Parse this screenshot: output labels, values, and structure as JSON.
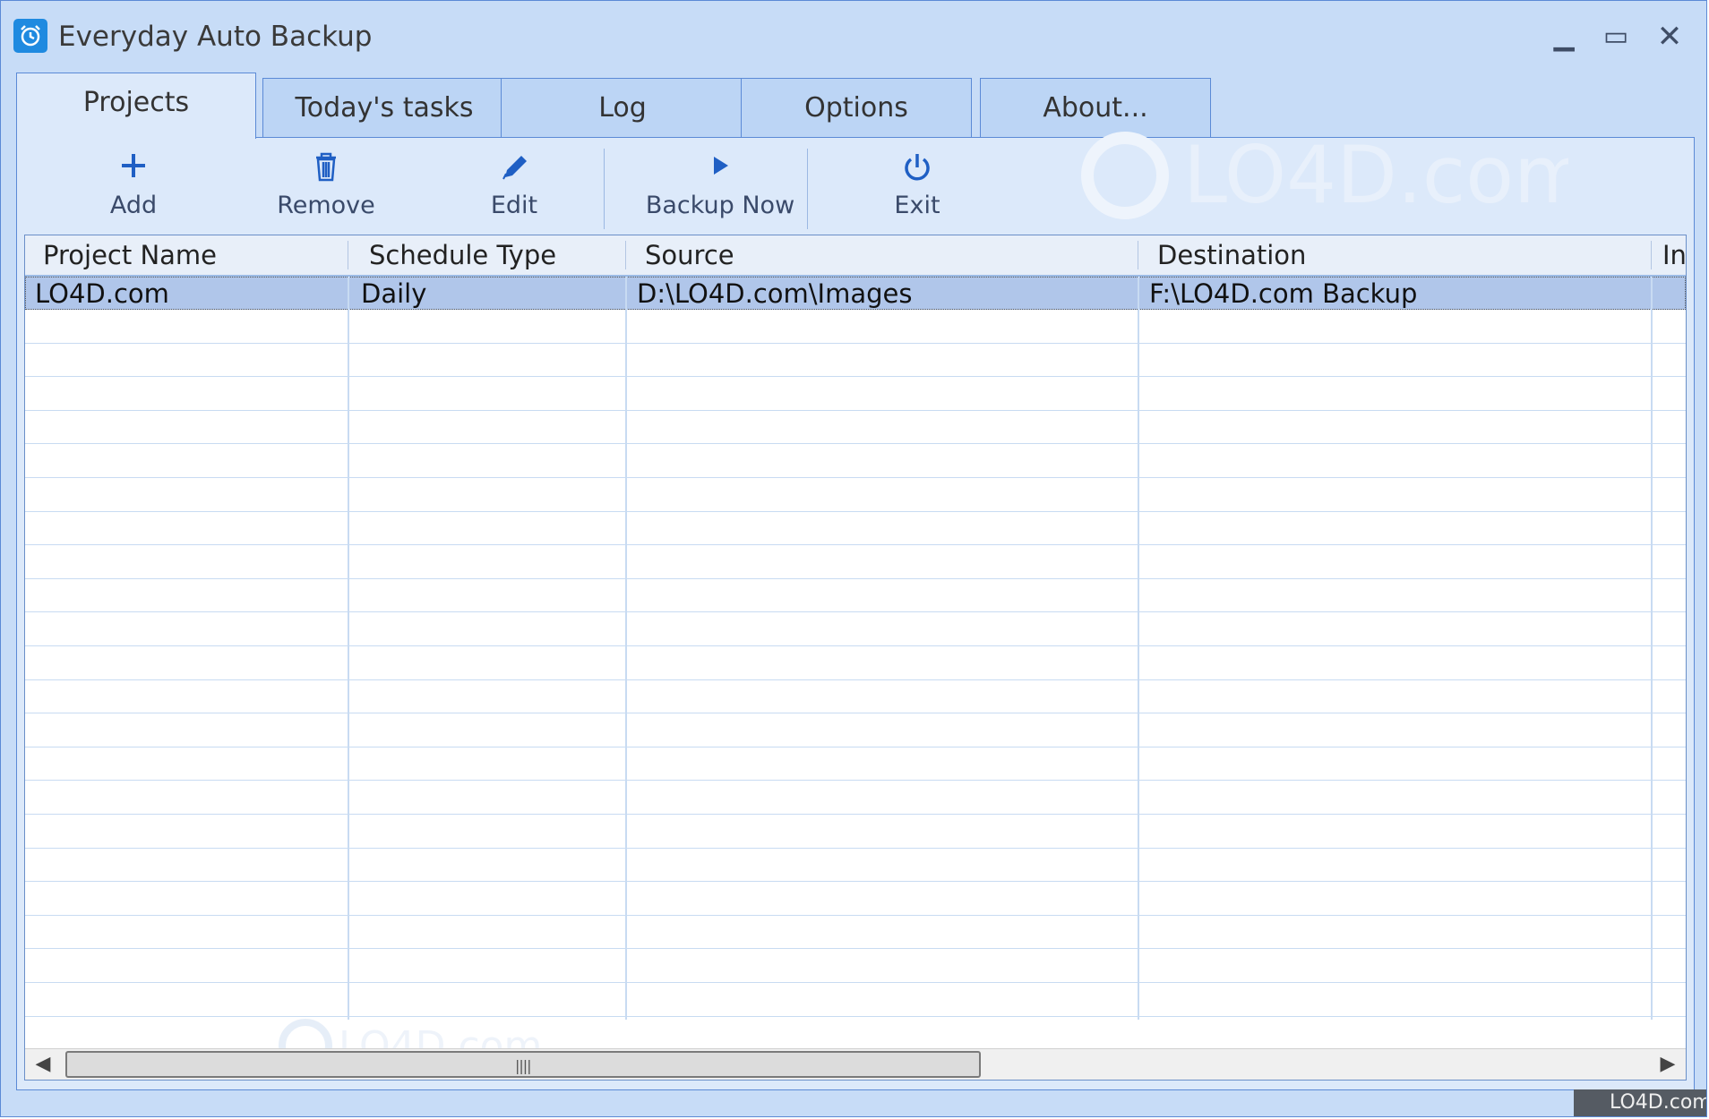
{
  "window": {
    "title": "Everyday Auto Backup",
    "controls": {
      "minimize": "▁",
      "maximize": "▭",
      "close": "✕"
    }
  },
  "tabs": [
    {
      "label": "Projects",
      "active": true
    },
    {
      "label": "Today's tasks",
      "active": false
    },
    {
      "label": "Log",
      "active": false
    },
    {
      "label": "Options",
      "active": false
    },
    {
      "label": "About...",
      "active": false
    }
  ],
  "toolbar": {
    "add": {
      "label": "Add",
      "icon": "plus-icon"
    },
    "remove": {
      "label": "Remove",
      "icon": "trash-icon"
    },
    "edit": {
      "label": "Edit",
      "icon": "pencil-icon"
    },
    "backup_now": {
      "label": "Backup Now",
      "icon": "play-icon"
    },
    "exit": {
      "label": "Exit",
      "icon": "power-icon"
    }
  },
  "table": {
    "columns": [
      "Project Name",
      "Schedule Type",
      "Source",
      "Destination",
      "In"
    ],
    "rows": [
      {
        "project_name": "LO4D.com",
        "schedule_type": "Daily",
        "source": "D:\\LO4D.com\\Images",
        "destination": "F:\\LO4D.com Backup",
        "extra": "",
        "selected": true
      }
    ]
  },
  "watermark": {
    "text": "LO4D.com"
  },
  "corner_badge": {
    "text": "LO4D.com"
  },
  "colors": {
    "accent": "#1f5fc4",
    "window_bg": "#c7dcf7",
    "panel_bg": "#dce9fa",
    "selection": "#b0c6ea"
  }
}
